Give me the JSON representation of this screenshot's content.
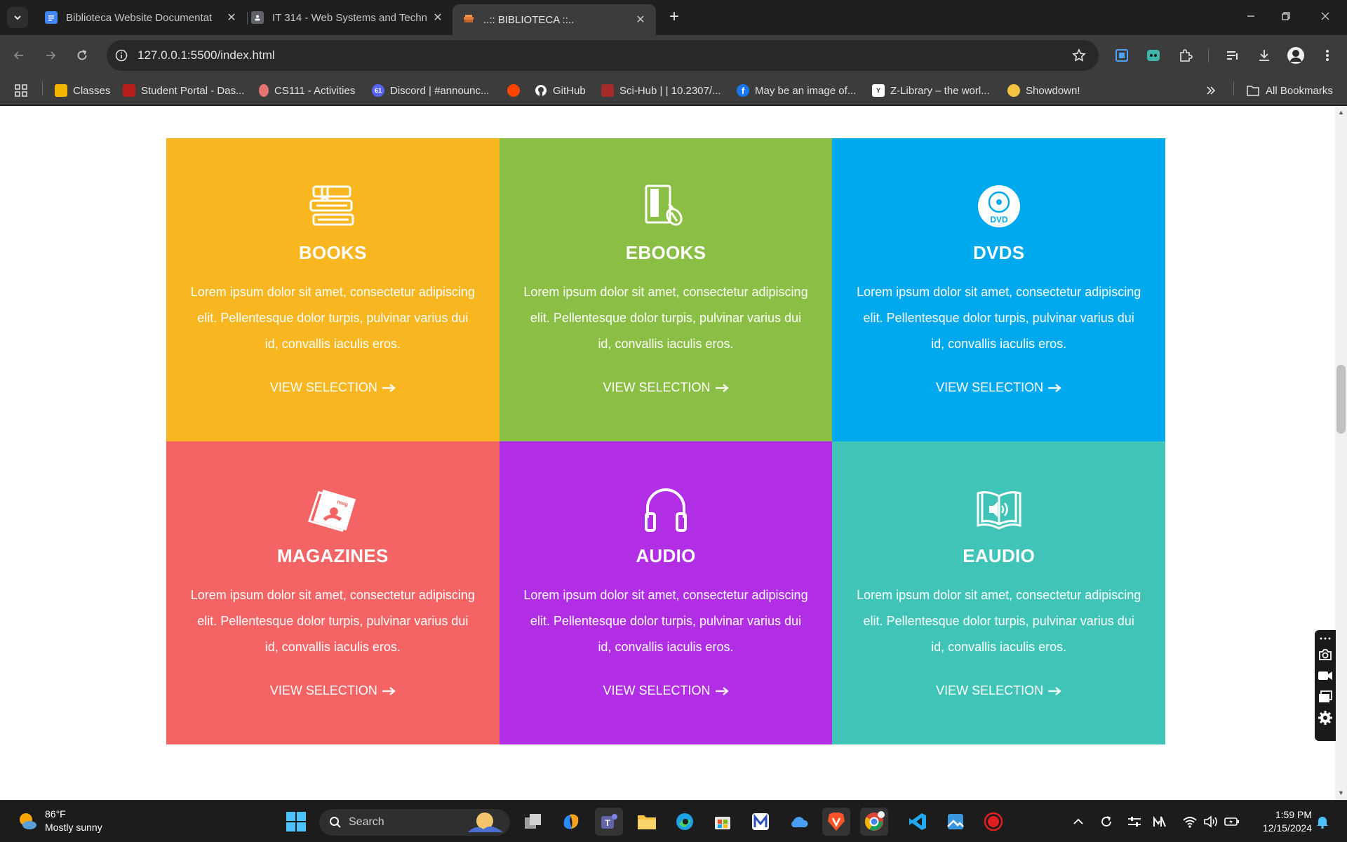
{
  "browser": {
    "tabs": [
      {
        "title": "Biblioteca Website Documentat",
        "favicon": "docs-icon",
        "active": false
      },
      {
        "title": "IT 314 - Web Systems and Techn",
        "favicon": "classroom-icon",
        "active": false
      },
      {
        "title": "..:: BIBLIOTECA ::..",
        "favicon": "library-icon",
        "active": true
      }
    ],
    "address": "127.0.0.1:5500/index.html",
    "bookmarks": [
      {
        "label": "Classes",
        "favicon_color": "#f4b400"
      },
      {
        "label": "Student Portal - Das...",
        "favicon_color": "#b71c1c"
      },
      {
        "label": "CS111 - Activities",
        "favicon_color": "#e57373"
      },
      {
        "label": "Discord | #announc...",
        "favicon_color": "#5865f2",
        "badge": "61"
      },
      {
        "label": "",
        "favicon_color": "#ff4500"
      },
      {
        "label": "GitHub",
        "favicon_color": "#ffffff"
      },
      {
        "label": "Sci-Hub | | 10.2307/...",
        "favicon_color": "#a52a2a"
      },
      {
        "label": "May be an image of...",
        "favicon_color": "#1877f2"
      },
      {
        "label": "Z-Library – the worl...",
        "favicon_color": "#ffffff"
      },
      {
        "label": "Showdown!",
        "favicon_color": "#f5c542"
      }
    ],
    "all_bookmarks_label": "All Bookmarks"
  },
  "page": {
    "cards": [
      {
        "title": "BOOKS",
        "icon": "books-icon",
        "color": "#f8b621",
        "text": "Lorem ipsum dolor sit amet, consectetur adipiscing elit. Pellentesque dolor turpis, pulvinar varius dui id, convallis iaculis eros.",
        "link": "VIEW SELECTION"
      },
      {
        "title": "EBOOKS",
        "icon": "ebook-icon",
        "color": "#8abe44",
        "text": "Lorem ipsum dolor sit amet, consectetur adipiscing elit. Pellentesque dolor turpis, pulvinar varius dui id, convallis iaculis eros.",
        "link": "VIEW SELECTION"
      },
      {
        "title": "DVDS",
        "icon": "dvd-icon",
        "color": "#00a9ee",
        "text": "Lorem ipsum dolor sit amet, consectetur adipiscing elit. Pellentesque dolor turpis, pulvinar varius dui id, convallis iaculis eros.",
        "link": "VIEW SELECTION",
        "icon_label": "DVD"
      },
      {
        "title": "MAGAZINES",
        "icon": "magazine-icon",
        "color": "#f56464",
        "text": "Lorem ipsum dolor sit amet, consectetur adipiscing elit. Pellentesque dolor turpis, pulvinar varius dui id, convallis iaculis eros.",
        "link": "VIEW SELECTION"
      },
      {
        "title": "AUDIO",
        "icon": "headphones-icon",
        "color": "#b22ee4",
        "text": "Lorem ipsum dolor sit amet, consectetur adipiscing elit. Pellentesque dolor turpis, pulvinar varius dui id, convallis iaculis eros.",
        "link": "VIEW SELECTION"
      },
      {
        "title": "EAUDIO",
        "icon": "audiobook-icon",
        "color": "#41c4b8",
        "text": "Lorem ipsum dolor sit amet, consectetur adipiscing elit. Pellentesque dolor turpis, pulvinar varius dui id, convallis iaculis eros.",
        "link": "VIEW SELECTION"
      }
    ]
  },
  "taskbar": {
    "weather_temp": "86°F",
    "weather_desc": "Mostly sunny",
    "search_placeholder": "Search",
    "time": "1:59 PM",
    "date": "12/15/2024"
  }
}
